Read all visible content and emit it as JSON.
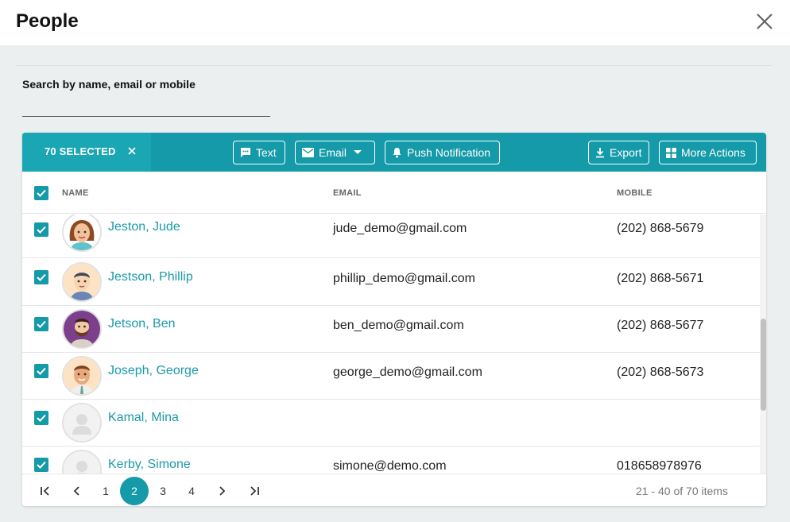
{
  "header": {
    "title": "People"
  },
  "search": {
    "label": "Search by name, email or mobile",
    "value": "",
    "placeholder": ""
  },
  "toolbar": {
    "selected_label": "70 SELECTED",
    "text_label": "Text",
    "email_label": "Email",
    "push_label": "Push Notification",
    "export_label": "Export",
    "more_label": "More Actions"
  },
  "columns": {
    "name": "NAME",
    "email": "EMAIL",
    "mobile": "MOBILE"
  },
  "rows": [
    {
      "name": "Jeston, Jude",
      "email": "jude_demo@gmail.com",
      "mobile": "(202) 868-5679",
      "avatar": "woman"
    },
    {
      "name": "Jestson, Phillip",
      "email": "phillip_demo@gmail.com",
      "mobile": "(202) 868-5671",
      "avatar": "man-dark-hair"
    },
    {
      "name": "Jetson, Ben",
      "email": "ben_demo@gmail.com",
      "mobile": "(202) 868-5677",
      "avatar": "man-beard"
    },
    {
      "name": "Joseph, George",
      "email": "george_demo@gmail.com",
      "mobile": "(202) 868-5673",
      "avatar": "man-tie"
    },
    {
      "name": "Kamal, Mina",
      "email": "",
      "mobile": "",
      "avatar": "placeholder"
    },
    {
      "name": "Kerby, Simone",
      "email": "simone@demo.com",
      "mobile": "018658978976",
      "avatar": "placeholder"
    }
  ],
  "pagination": {
    "pages": [
      "1",
      "2",
      "3",
      "4"
    ],
    "current": "2",
    "info": "21 - 40 of 70 items"
  },
  "colors": {
    "accent": "#149aa8",
    "link": "#1b9aa8"
  }
}
